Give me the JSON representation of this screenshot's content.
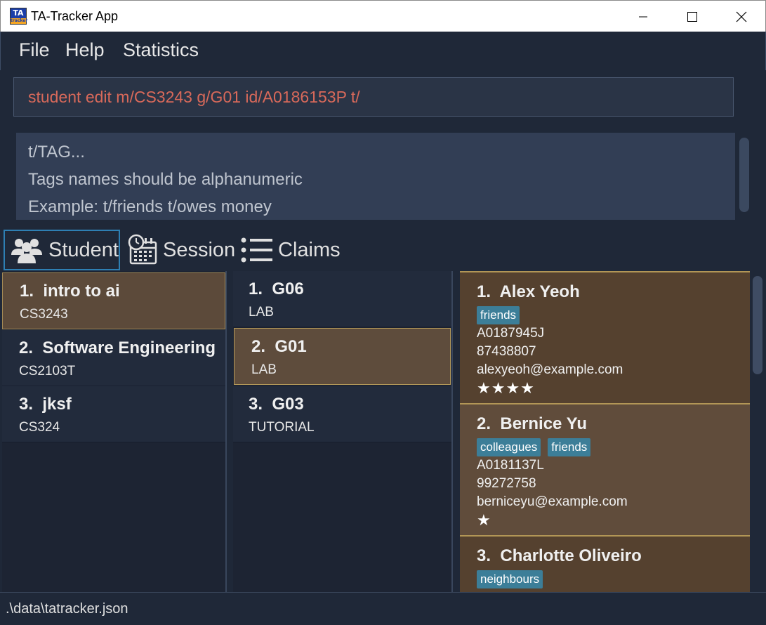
{
  "window": {
    "title": "TA-Tracker App",
    "icon_text_top": "TA",
    "icon_text_bottom": "tracker"
  },
  "menu": [
    "File",
    "Help",
    "Statistics"
  ],
  "command": {
    "value": "student edit m/CS3243 g/G01 id/A0186153P t/",
    "text_color": "#d8695a"
  },
  "result": {
    "lines": [
      "t/TAG...",
      "Tags names should be alphanumeric",
      "Example: t/friends t/owes money"
    ]
  },
  "tabs": [
    {
      "label": "Student",
      "icon": "students-icon",
      "selected": true
    },
    {
      "label": "Session",
      "icon": "calendar-clock-icon",
      "selected": false
    },
    {
      "label": "Claims",
      "icon": "list-icon",
      "selected": false
    }
  ],
  "modules": [
    {
      "index": "1.",
      "name": "intro to ai",
      "code": "CS3243",
      "selected": true
    },
    {
      "index": "2.",
      "name": "Software Engineering",
      "code": "CS2103T",
      "selected": false
    },
    {
      "index": "3.",
      "name": "jksf",
      "code": "CS324",
      "selected": false
    }
  ],
  "groups": [
    {
      "index": "1.",
      "name": "G06",
      "type": "LAB",
      "selected": false
    },
    {
      "index": "2.",
      "name": "G01",
      "type": "LAB",
      "selected": true
    },
    {
      "index": "3.",
      "name": "G03",
      "type": "TUTORIAL",
      "selected": false
    }
  ],
  "students": [
    {
      "index": "1.",
      "name": "Alex Yeoh",
      "tags": [
        "friends"
      ],
      "matric": "A0187945J",
      "phone": "87438807",
      "email": "alexyeoh@example.com",
      "rating": "★★★★"
    },
    {
      "index": "2.",
      "name": "Bernice Yu",
      "tags": [
        "colleagues",
        "friends"
      ],
      "matric": "A0181137L",
      "phone": "99272758",
      "email": "berniceyu@example.com",
      "rating": "★"
    },
    {
      "index": "3.",
      "name": "Charlotte Oliveiro",
      "tags": [
        "neighbours"
      ]
    }
  ],
  "status": {
    "path": ".\\data\\tatracker.json"
  },
  "colors": {
    "background": "#1f2838",
    "selected_card": "#5c4a3a",
    "tag": "#3c7e98",
    "tab_border": "#2e7fb3"
  }
}
